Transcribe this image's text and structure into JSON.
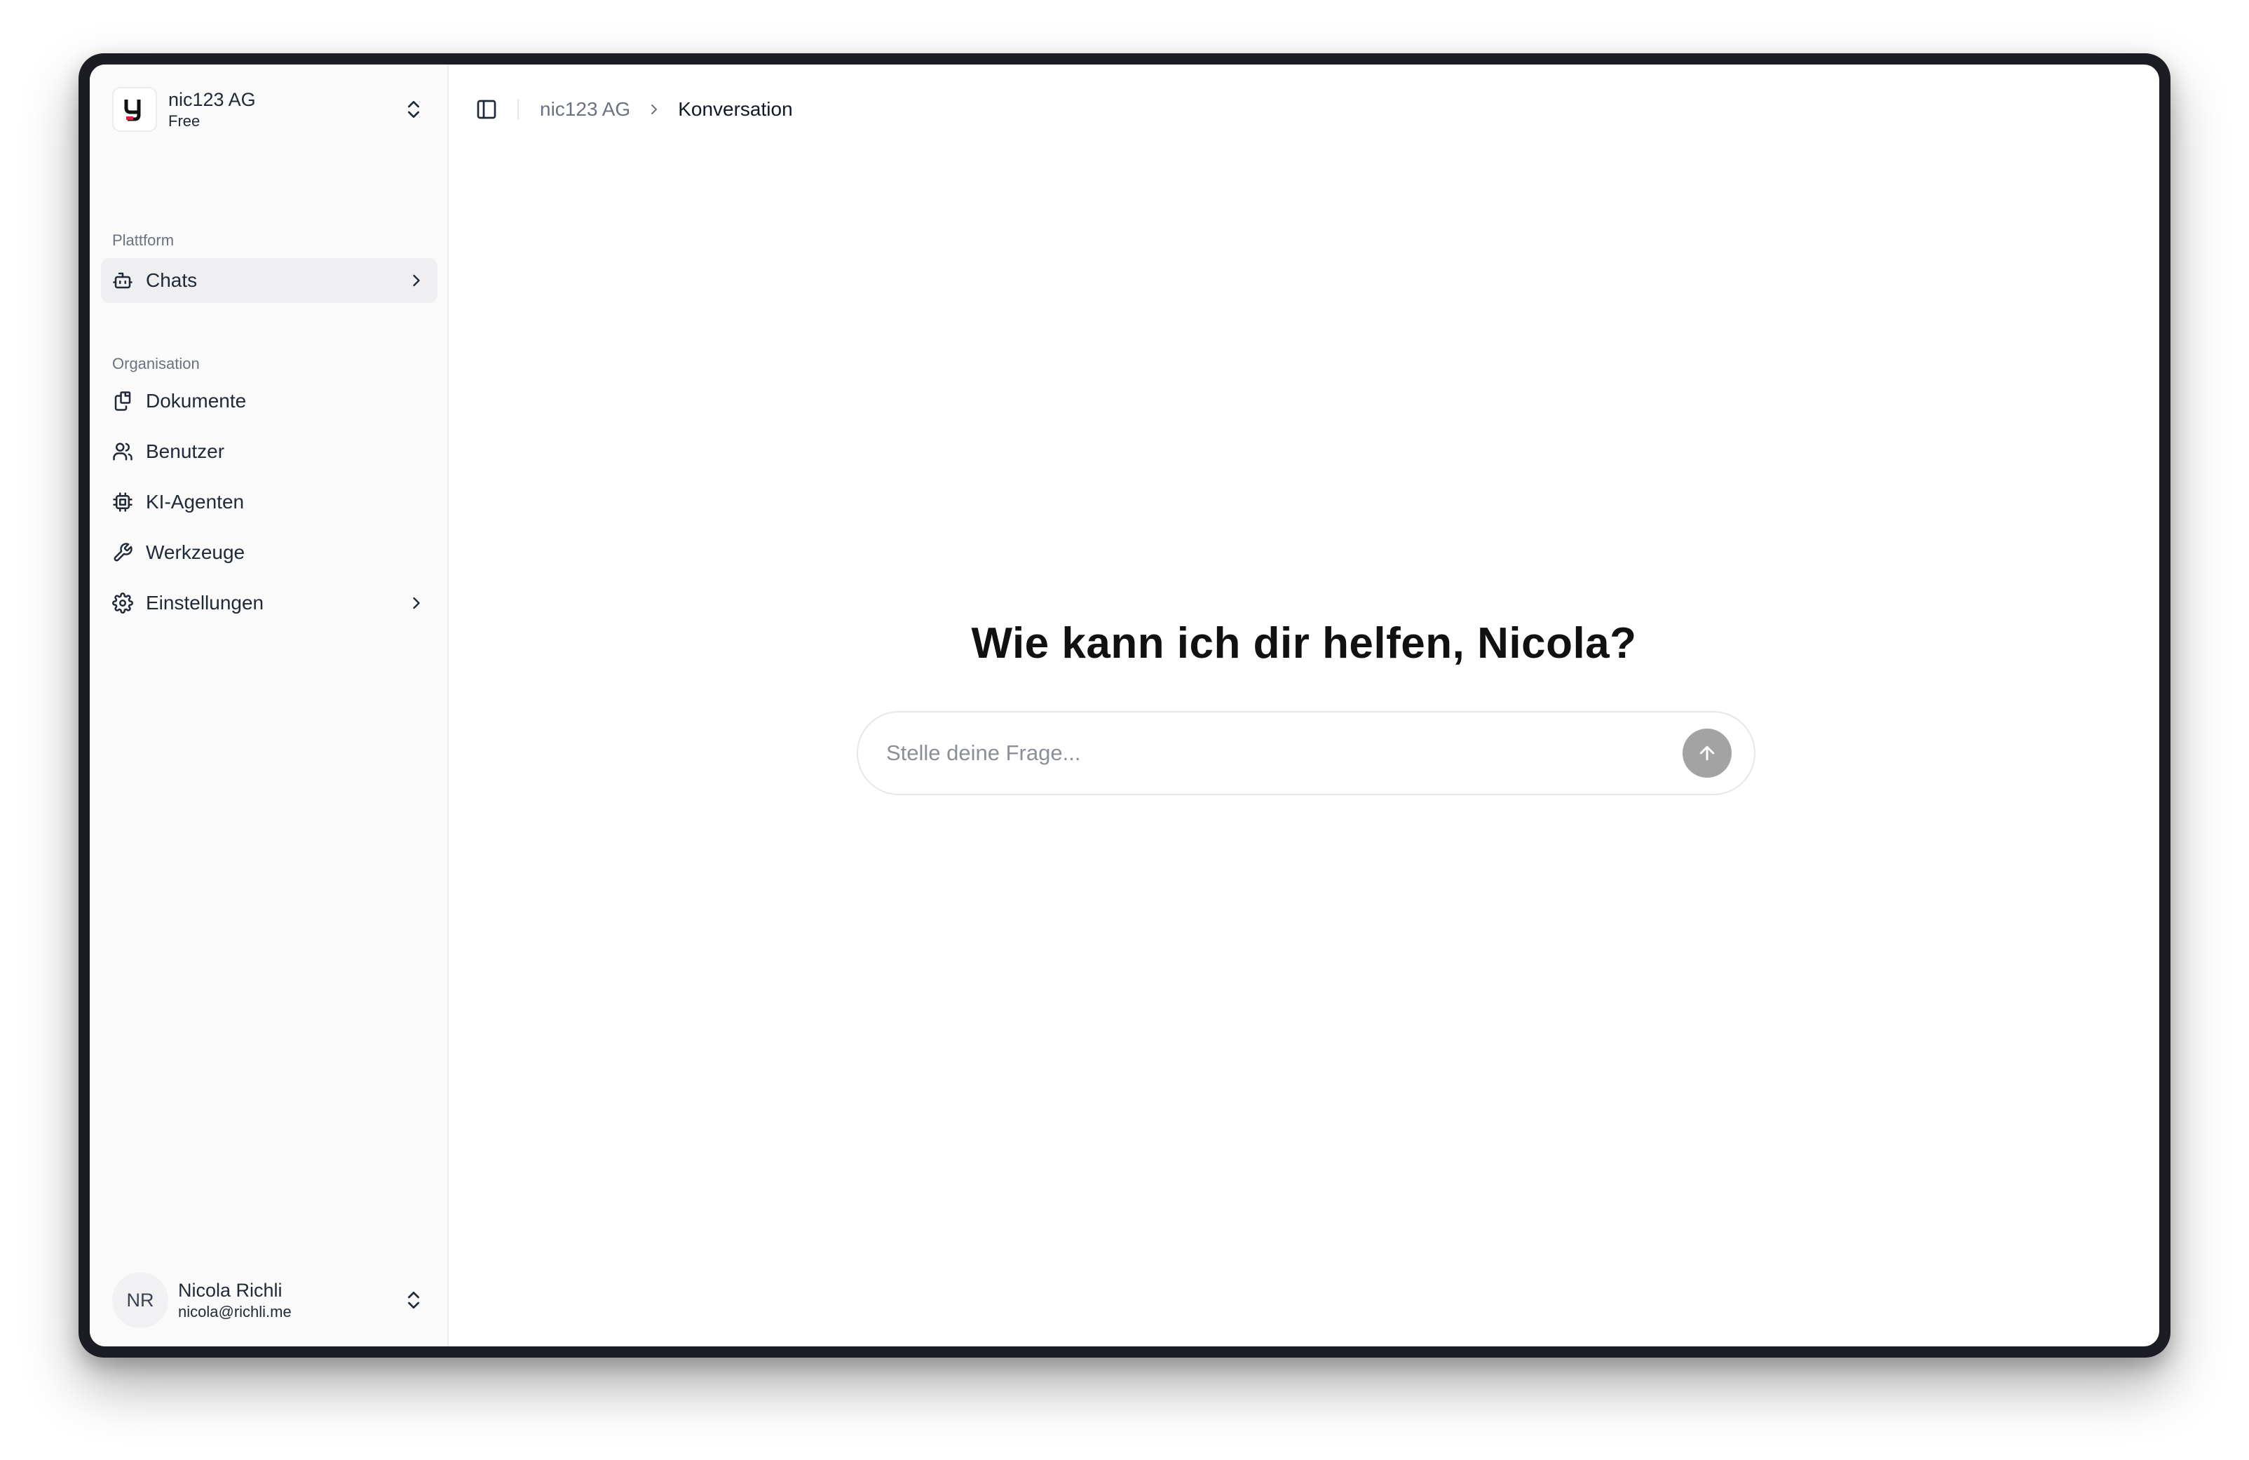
{
  "org": {
    "name": "nic123 AG",
    "plan": "Free"
  },
  "sidebar": {
    "groups": [
      {
        "label": "Plattform",
        "items": [
          {
            "label": "Chats",
            "icon": "bot-icon",
            "active": true,
            "has_submenu": true
          }
        ]
      },
      {
        "label": "Organisation",
        "items": [
          {
            "label": "Dokumente",
            "icon": "documents-icon"
          },
          {
            "label": "Benutzer",
            "icon": "users-icon"
          },
          {
            "label": "KI-Agenten",
            "icon": "cpu-icon"
          },
          {
            "label": "Werkzeuge",
            "icon": "wrench-icon"
          },
          {
            "label": "Einstellungen",
            "icon": "settings-icon",
            "has_submenu": true
          }
        ]
      }
    ]
  },
  "user": {
    "initials": "NR",
    "name": "Nicola Richli",
    "email": "nicola@richli.me"
  },
  "breadcrumb": {
    "parent": "nic123 AG",
    "current": "Konversation"
  },
  "main": {
    "greeting": "Wie kann ich dir helfen, Nicola?",
    "input_placeholder": "Stelle deine Frage...",
    "input_value": ""
  },
  "colors": {
    "send_button": "#a3a3a3",
    "active_item_bg": "#efeff1",
    "device_frame": "#1c1d24"
  }
}
